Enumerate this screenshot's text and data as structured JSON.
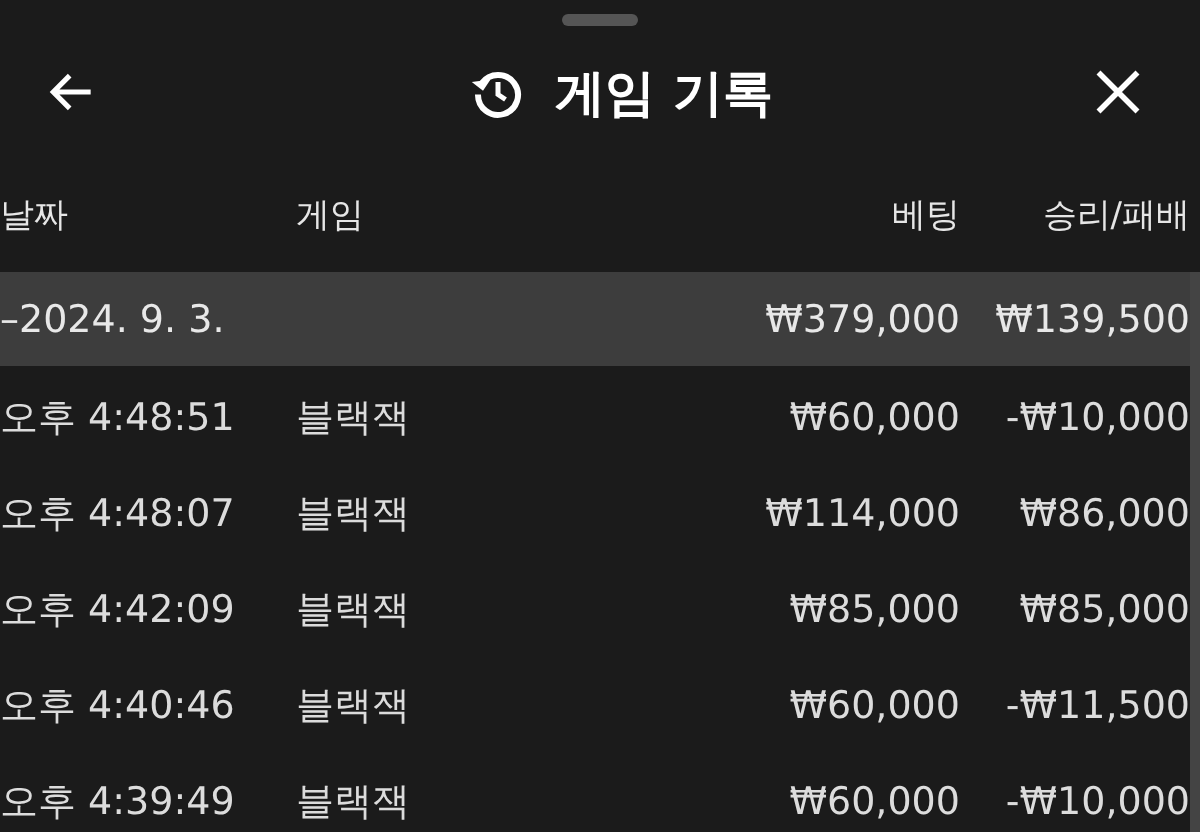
{
  "header": {
    "title": "게임 기록"
  },
  "columns": [
    "날짜",
    "게임",
    "베팅",
    "승리/패배"
  ],
  "rows": [
    {
      "kind": "group",
      "date": "–2024. 9. 3.",
      "game": "",
      "bet": "₩379,000",
      "result": "₩139,500"
    },
    {
      "kind": "game",
      "date": "오후 4:48:51",
      "game": "블랙잭",
      "bet": "₩60,000",
      "result": "-₩10,000"
    },
    {
      "kind": "game",
      "date": "오후 4:48:07",
      "game": "블랙잭",
      "bet": "₩114,000",
      "result": "₩86,000"
    },
    {
      "kind": "game",
      "date": "오후 4:42:09",
      "game": "블랙잭",
      "bet": "₩85,000",
      "result": "₩85,000"
    },
    {
      "kind": "game",
      "date": "오후 4:40:46",
      "game": "블랙잭",
      "bet": "₩60,000",
      "result": "-₩11,500"
    },
    {
      "kind": "game",
      "date": "오후 4:39:49",
      "game": "블랙잭",
      "bet": "₩60,000",
      "result": "-₩10,000"
    }
  ]
}
